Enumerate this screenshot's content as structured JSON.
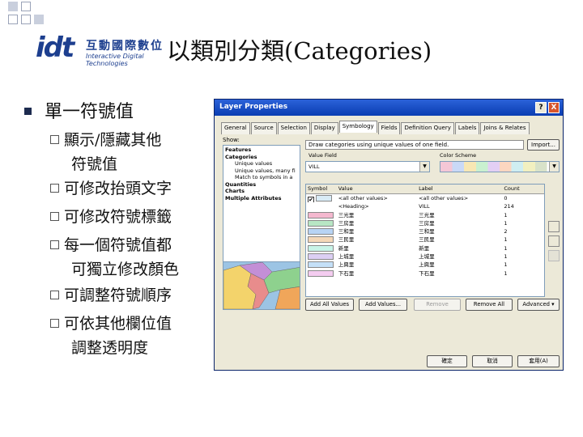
{
  "slide": {
    "logo_mark": "idt",
    "logo_zh": "互動國際數位",
    "logo_en": "Interactive Digital Technologies",
    "title": "以類別分類(Categories)",
    "main_bullet": "單一符號值",
    "sub_bullets": [
      {
        "line1": "顯示/隱藏其他",
        "line2": "符號值"
      },
      {
        "line1": "可修改抬頭文字",
        "line2": ""
      },
      {
        "line1": "可修改符號標籤",
        "line2": ""
      },
      {
        "line1": "每一個符號值都",
        "line2": "可獨立修改顏色"
      },
      {
        "line1": "可調整符號順序",
        "line2": ""
      },
      {
        "line1": "可依其他欄位值",
        "line2": "調整透明度"
      }
    ]
  },
  "dialog": {
    "title": "Layer Properties",
    "title_buttons": [
      "?",
      "X"
    ],
    "tabs": [
      "General",
      "Source",
      "Selection",
      "Display",
      "Symbology",
      "Fields",
      "Definition Query",
      "Labels",
      "Joins & Relates"
    ],
    "active_tab": "Symbology",
    "show_label": "Show:",
    "show_items": [
      {
        "text": "Features",
        "bold": true,
        "indent": false
      },
      {
        "text": "Categories",
        "bold": true,
        "indent": false
      },
      {
        "text": "Unique values",
        "bold": false,
        "indent": true
      },
      {
        "text": "Unique values, many fi",
        "bold": false,
        "indent": true
      },
      {
        "text": "Match to symbols in a",
        "bold": false,
        "indent": true
      },
      {
        "text": "Quantities",
        "bold": true,
        "indent": false
      },
      {
        "text": "Charts",
        "bold": true,
        "indent": false
      },
      {
        "text": "Multiple Attributes",
        "bold": true,
        "indent": false
      }
    ],
    "description": "Draw categories using unique values of one field.",
    "import_label": "Import...",
    "value_field_label": "Value Field",
    "value_field_value": "VILL",
    "color_scheme_label": "Color Scheme",
    "table_headers": [
      "Symbol",
      "Value",
      "Label",
      "Count"
    ],
    "rows": [
      {
        "checked": true,
        "color": "#d9ecf7",
        "value": "<all other values>",
        "label": "<all other values>",
        "count": "0"
      },
      {
        "checked": false,
        "color": "",
        "value": "<Heading>",
        "label": "VILL",
        "count": "214"
      },
      {
        "checked": false,
        "color": "#f4b8cf",
        "value": "三光里",
        "label": "三光里",
        "count": "1"
      },
      {
        "checked": false,
        "color": "#b8e6c4",
        "value": "三房里",
        "label": "三房里",
        "count": "1"
      },
      {
        "checked": false,
        "color": "#b8d4f4",
        "value": "三和里",
        "label": "三和里",
        "count": "2"
      },
      {
        "checked": false,
        "color": "#f4d8b8",
        "value": "三民里",
        "label": "三民里",
        "count": "1"
      },
      {
        "checked": false,
        "color": "#c8f4e8",
        "value": "新里",
        "label": "新里",
        "count": "1"
      },
      {
        "checked": false,
        "color": "#dccff4",
        "value": "上城里",
        "label": "上城里",
        "count": "1"
      },
      {
        "checked": false,
        "color": "#c4e0f8",
        "value": "上興里",
        "label": "上興里",
        "count": "1"
      },
      {
        "checked": false,
        "color": "#f4ccf0",
        "value": "下石里",
        "label": "下石里",
        "count": "1"
      }
    ],
    "buttons": {
      "add_all": "Add All Values",
      "add_values": "Add Values...",
      "remove": "Remove",
      "remove_all": "Remove All",
      "advanced": "Advanced ▾",
      "ok": "確定",
      "cancel": "取消",
      "apply": "套用(A)"
    }
  }
}
